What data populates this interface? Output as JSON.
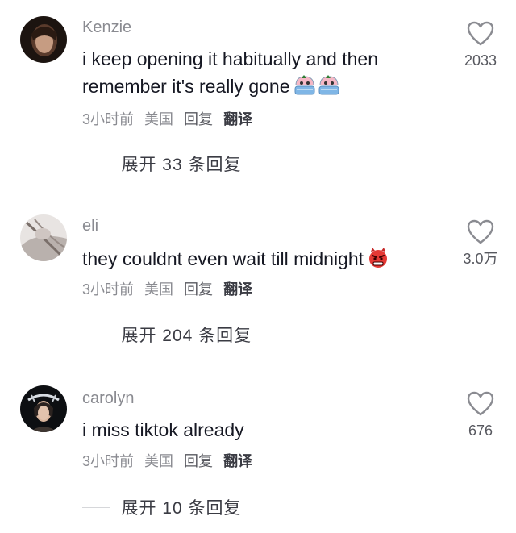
{
  "comments": [
    {
      "username": "Kenzie",
      "text_line1": "i keep opening it habitually and then",
      "text_line2": "remember it's really gone",
      "emoji": "crying-face-emoji x2",
      "time": "3小时前",
      "location": "美国",
      "reply": "回复",
      "translate": "翻译",
      "likes": "2033",
      "expand": "展开 33 条回复"
    },
    {
      "username": "eli",
      "text_line1": "they couldnt even wait till midnight",
      "emoji": "angry-devil-emoji",
      "time": "3小时前",
      "location": "美国",
      "reply": "回复",
      "translate": "翻译",
      "likes": "3.0万",
      "expand": "展开 204 条回复"
    },
    {
      "username": "carolyn",
      "text_line1": "i miss tiktok already",
      "time": "3小时前",
      "location": "美国",
      "reply": "回复",
      "translate": "翻译",
      "likes": "676",
      "expand": "展开 10 条回复"
    }
  ],
  "colors": {
    "username": "#8a8b91",
    "text": "#161823",
    "meta": "#8a8b91",
    "divider": "#d6d7da"
  }
}
